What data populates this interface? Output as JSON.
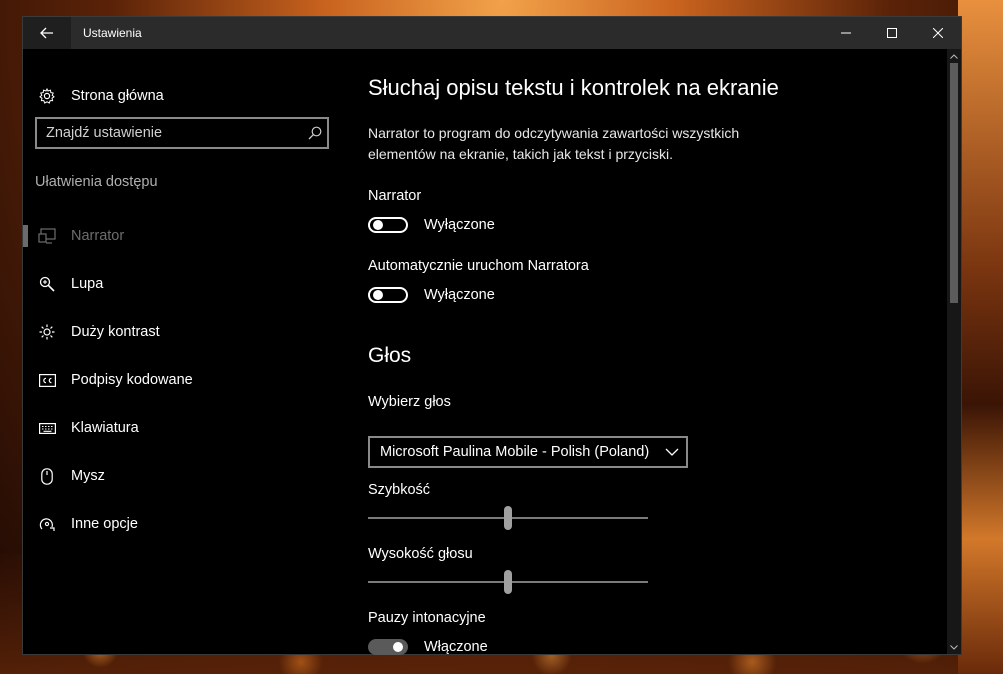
{
  "window": {
    "title": "Ustawienia"
  },
  "sidebar": {
    "home_label": "Strona główna",
    "search_placeholder": "Znajdź ustawienie",
    "section_label": "Ułatwienia dostępu",
    "items": [
      {
        "label": "Narrator",
        "icon": "narrator-icon",
        "selected": true
      },
      {
        "label": "Lupa",
        "icon": "magnifier-icon",
        "selected": false
      },
      {
        "label": "Duży kontrast",
        "icon": "brightness-icon",
        "selected": false
      },
      {
        "label": "Podpisy kodowane",
        "icon": "closed-captions-icon",
        "selected": false
      },
      {
        "label": "Klawiatura",
        "icon": "keyboard-icon",
        "selected": false
      },
      {
        "label": "Mysz",
        "icon": "mouse-icon",
        "selected": false
      },
      {
        "label": "Inne opcje",
        "icon": "other-options-icon",
        "selected": false
      }
    ]
  },
  "main": {
    "title": "Słuchaj opisu tekstu i kontrolek na ekranie",
    "description": "Narrator to program do odczytywania zawartości wszystkich elementów na ekranie, takich jak tekst i przyciski.",
    "narrator": {
      "label": "Narrator",
      "state_label": "Wyłączone",
      "on": false
    },
    "auto_start": {
      "label": "Automatycznie uruchom Narratora",
      "state_label": "Wyłączone",
      "on": false
    },
    "voice_section": "Głos",
    "voice_select": {
      "label": "Wybierz głos",
      "value": "Microsoft Paulina Mobile - Polish (Poland)"
    },
    "speed": {
      "label": "Szybkość",
      "value_fraction": 0.5
    },
    "pitch": {
      "label": "Wysokość głosu",
      "value_fraction": 0.5
    },
    "pauses": {
      "label": "Pauzy intonacyjne",
      "state_label": "Włączone",
      "on": true
    }
  }
}
